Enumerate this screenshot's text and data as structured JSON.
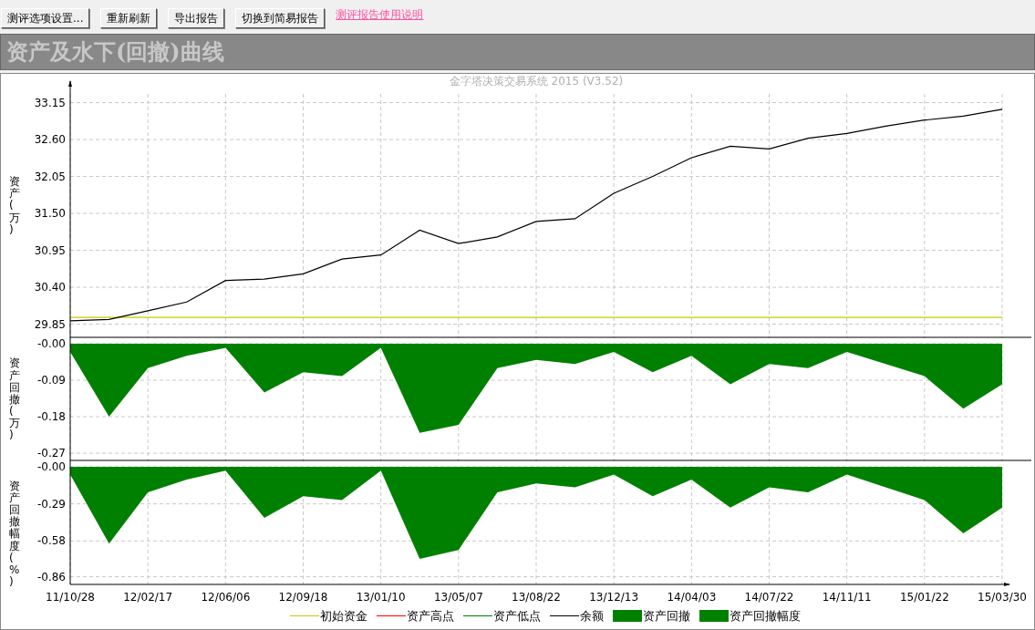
{
  "toolbar": {
    "buttons": [
      {
        "label": "测评选项设置..."
      },
      {
        "label": "重新刷新"
      },
      {
        "label": "导出报告"
      },
      {
        "label": "切换到简易报告"
      }
    ],
    "link": "测评报告使用说明"
  },
  "header": {
    "title": "资产及水下(回撤)曲线"
  },
  "charts": [
    {
      "chart_data": {
        "type": "line",
        "title": "金字塔决策交易系统 2015 (V3.52)",
        "ylabel": "资产(万)",
        "grid": true,
        "ylim": [
          29.64,
          33.28
        ],
        "yticks": [
          {
            "value": 29.85,
            "label": "29.85"
          },
          {
            "value": 30.4,
            "label": "30.40"
          },
          {
            "value": 30.95,
            "label": "30.95"
          },
          {
            "value": 31.5,
            "label": "31.50"
          },
          {
            "value": 32.05,
            "label": "32.05"
          },
          {
            "value": 32.6,
            "label": "32.60"
          },
          {
            "value": 33.15,
            "label": "33.15"
          }
        ],
        "series": [
          {
            "color": "#c8c800",
            "values": [
              29.95,
              29.95,
              29.95,
              29.95,
              29.95,
              29.95,
              29.95,
              29.95,
              29.95,
              29.95,
              29.95,
              29.95,
              29.95,
              29.95,
              29.95,
              29.95,
              29.95,
              29.95,
              29.95,
              29.95,
              29.95,
              29.95,
              29.95,
              29.95,
              29.95
            ]
          },
          {
            "color": "#000000",
            "values": [
              29.9,
              29.92,
              30.05,
              30.18,
              30.5,
              30.52,
              30.6,
              30.82,
              30.88,
              31.25,
              31.05,
              31.15,
              31.38,
              31.42,
              31.8,
              32.05,
              32.33,
              32.5,
              32.46,
              32.62,
              32.69,
              32.8,
              32.89,
              32.95,
              33.05
            ]
          }
        ]
      }
    },
    {
      "chart_data": {
        "type": "area",
        "ylabel": "资产回撤(万)",
        "grid": true,
        "ylim": [
          -0.29,
          0
        ],
        "yticks": [
          {
            "value": 0,
            "label": "-0.00"
          },
          {
            "value": -0.09,
            "label": "-0.09"
          },
          {
            "value": -0.18,
            "label": "-0.18"
          },
          {
            "value": -0.27,
            "label": "-0.27"
          }
        ],
        "series": [
          {
            "color": "#008000",
            "values": [
              -0.02,
              -0.18,
              -0.06,
              -0.03,
              -0.01,
              -0.12,
              -0.07,
              -0.08,
              -0.01,
              -0.22,
              -0.2,
              -0.06,
              -0.04,
              -0.05,
              -0.02,
              -0.07,
              -0.03,
              -0.1,
              -0.05,
              -0.06,
              -0.02,
              -0.05,
              -0.08,
              -0.16,
              -0.1
            ]
          }
        ]
      }
    },
    {
      "chart_data": {
        "type": "area",
        "ylabel": "资产回撤幅度(%)",
        "categories": [
          "11/10/28",
          null,
          "12/02/17",
          null,
          "12/06/06",
          null,
          "12/09/18",
          null,
          "13/01/10",
          null,
          "13/05/07",
          null,
          "13/08/22",
          null,
          "13/12/13",
          null,
          "14/04/03",
          null,
          "14/07/22",
          null,
          "14/11/11",
          null,
          "15/01/22",
          null,
          "15/03/30"
        ],
        "grid": true,
        "ylim": [
          -0.92,
          0
        ],
        "yticks": [
          {
            "value": 0,
            "label": "-0.00"
          },
          {
            "value": -0.29,
            "label": "-0.29"
          },
          {
            "value": -0.58,
            "label": "-0.58"
          },
          {
            "value": -0.86,
            "label": "-0.86"
          }
        ],
        "series": [
          {
            "color": "#008000",
            "values": [
              -0.06,
              -0.6,
              -0.2,
              -0.1,
              -0.03,
              -0.4,
              -0.23,
              -0.26,
              -0.03,
              -0.72,
              -0.65,
              -0.2,
              -0.13,
              -0.16,
              -0.06,
              -0.23,
              -0.1,
              -0.32,
              -0.16,
              -0.2,
              -0.06,
              -0.16,
              -0.26,
              -0.52,
              -0.32
            ]
          }
        ]
      }
    }
  ],
  "legend": [
    {
      "label": "初始资金",
      "kind": "line",
      "color": "#c8c800"
    },
    {
      "label": "资产高点",
      "kind": "line",
      "color": "#ff0000"
    },
    {
      "label": "资产低点",
      "kind": "line",
      "color": "#008000"
    },
    {
      "label": "余额",
      "kind": "line",
      "color": "#000000"
    },
    {
      "label": "资产回撤",
      "kind": "block",
      "color": "#008000"
    },
    {
      "label": "资产回撤幅度",
      "kind": "block",
      "color": "#008000"
    }
  ]
}
